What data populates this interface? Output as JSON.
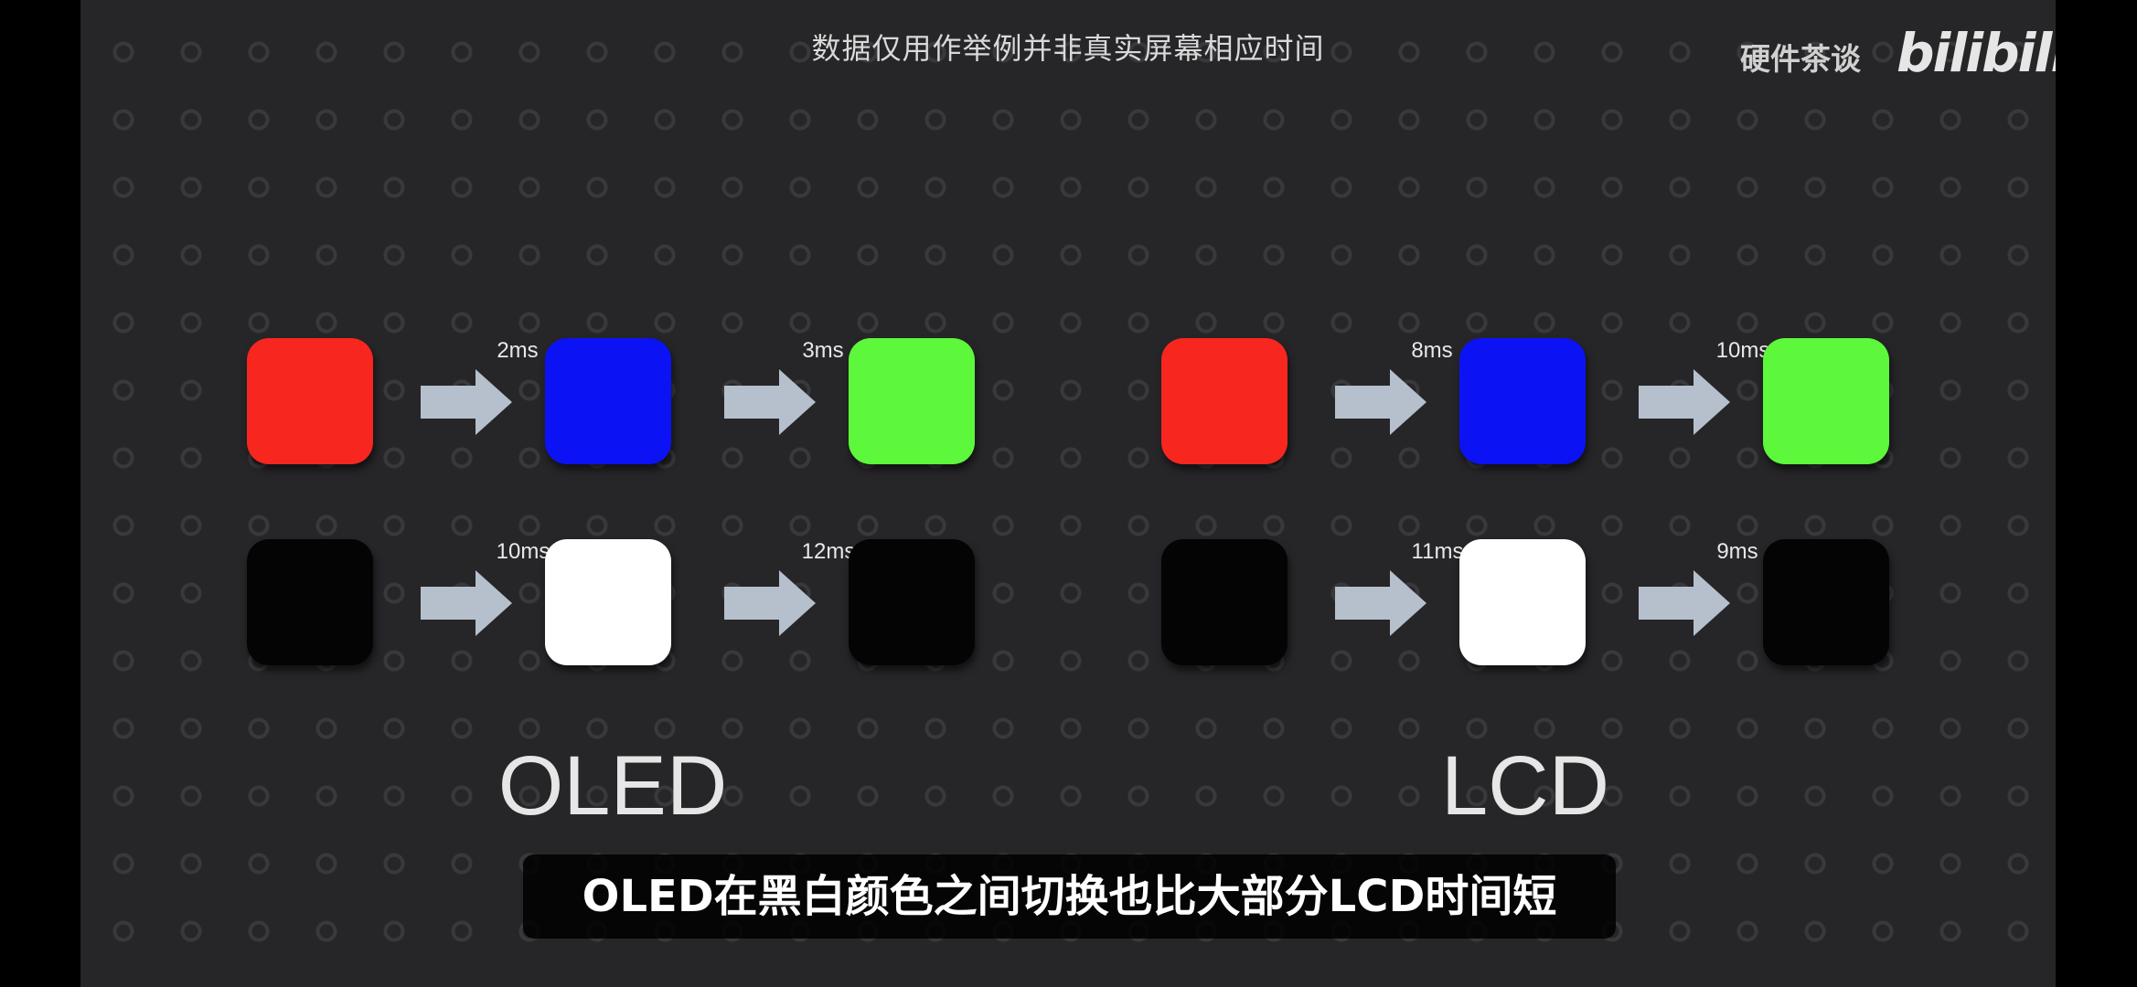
{
  "disclaimer": "数据仅用作举例并非真实屏幕相应时间",
  "watermark": "硬件茶谈",
  "logo": "bilibili",
  "colors": {
    "red": "#f7271f",
    "blue": "#0b13f5",
    "green": "#5df73c",
    "black": "#040404",
    "white": "#ffffff",
    "arrow": "#b5c0cc"
  },
  "panels": [
    {
      "label": "OLED",
      "row1": {
        "colors": [
          "red",
          "blue",
          "green"
        ],
        "times": [
          "2ms",
          "3ms"
        ]
      },
      "row2": {
        "colors": [
          "black",
          "white",
          "black"
        ],
        "times": [
          "10ms",
          "12ms"
        ]
      }
    },
    {
      "label": "LCD",
      "row1": {
        "colors": [
          "red",
          "blue",
          "green"
        ],
        "times": [
          "8ms",
          "10ms"
        ]
      },
      "row2": {
        "colors": [
          "black",
          "white",
          "black"
        ],
        "times": [
          "11ms",
          "9ms"
        ]
      }
    }
  ],
  "subtitle": "OLED在黑白颜色之间切换也比大部分LCD时间短"
}
